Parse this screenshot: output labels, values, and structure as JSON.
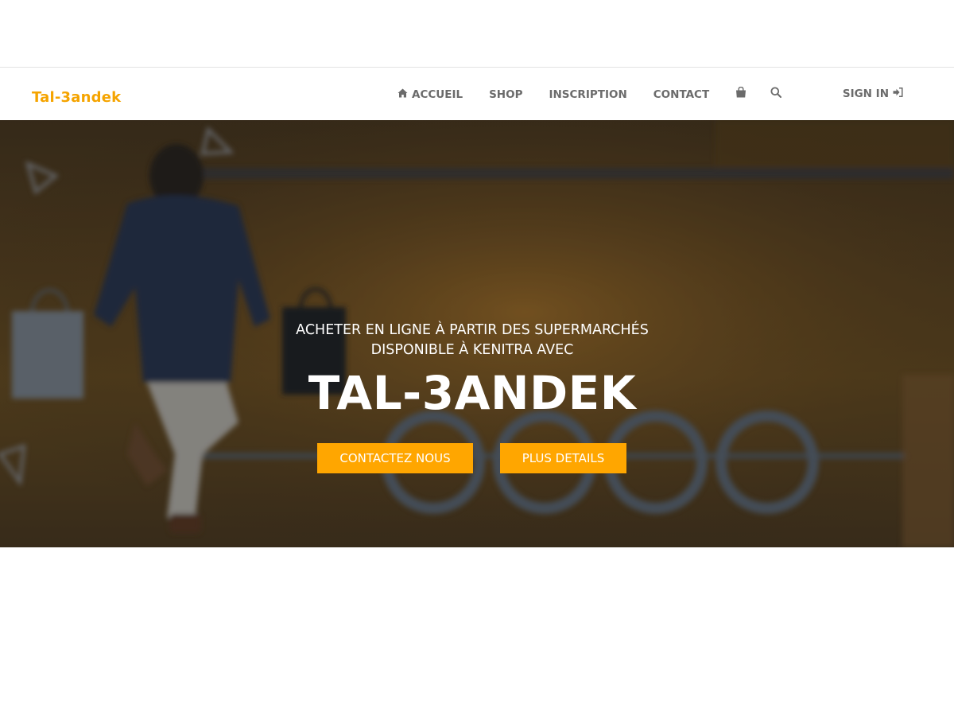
{
  "brand": {
    "name": "Tal-3andek",
    "color": "#f5a400"
  },
  "nav": {
    "items": [
      {
        "label": "ACCUEIL",
        "icon": "home-icon"
      },
      {
        "label": "SHOP"
      },
      {
        "label": "INSCRIPTION"
      },
      {
        "label": "CONTACT"
      }
    ],
    "cart_icon": "shopping-bag-icon",
    "search_icon": "search-icon",
    "signin": {
      "label": "SIGN IN",
      "icon": "sign-in-icon"
    }
  },
  "hero": {
    "subtitle_line1": "ACHETER EN LIGNE À PARTIR DES SUPERMARCHÉS",
    "subtitle_line2": "DISPONIBLE À KENITRA AVEC",
    "title": "TAL-3ANDEK",
    "buttons": {
      "contact": "CONTACTEZ NOUS",
      "details": "PLUS DETAILS"
    },
    "button_color": "#ffa600",
    "background_image": "shopping-man-with-bags-background"
  }
}
